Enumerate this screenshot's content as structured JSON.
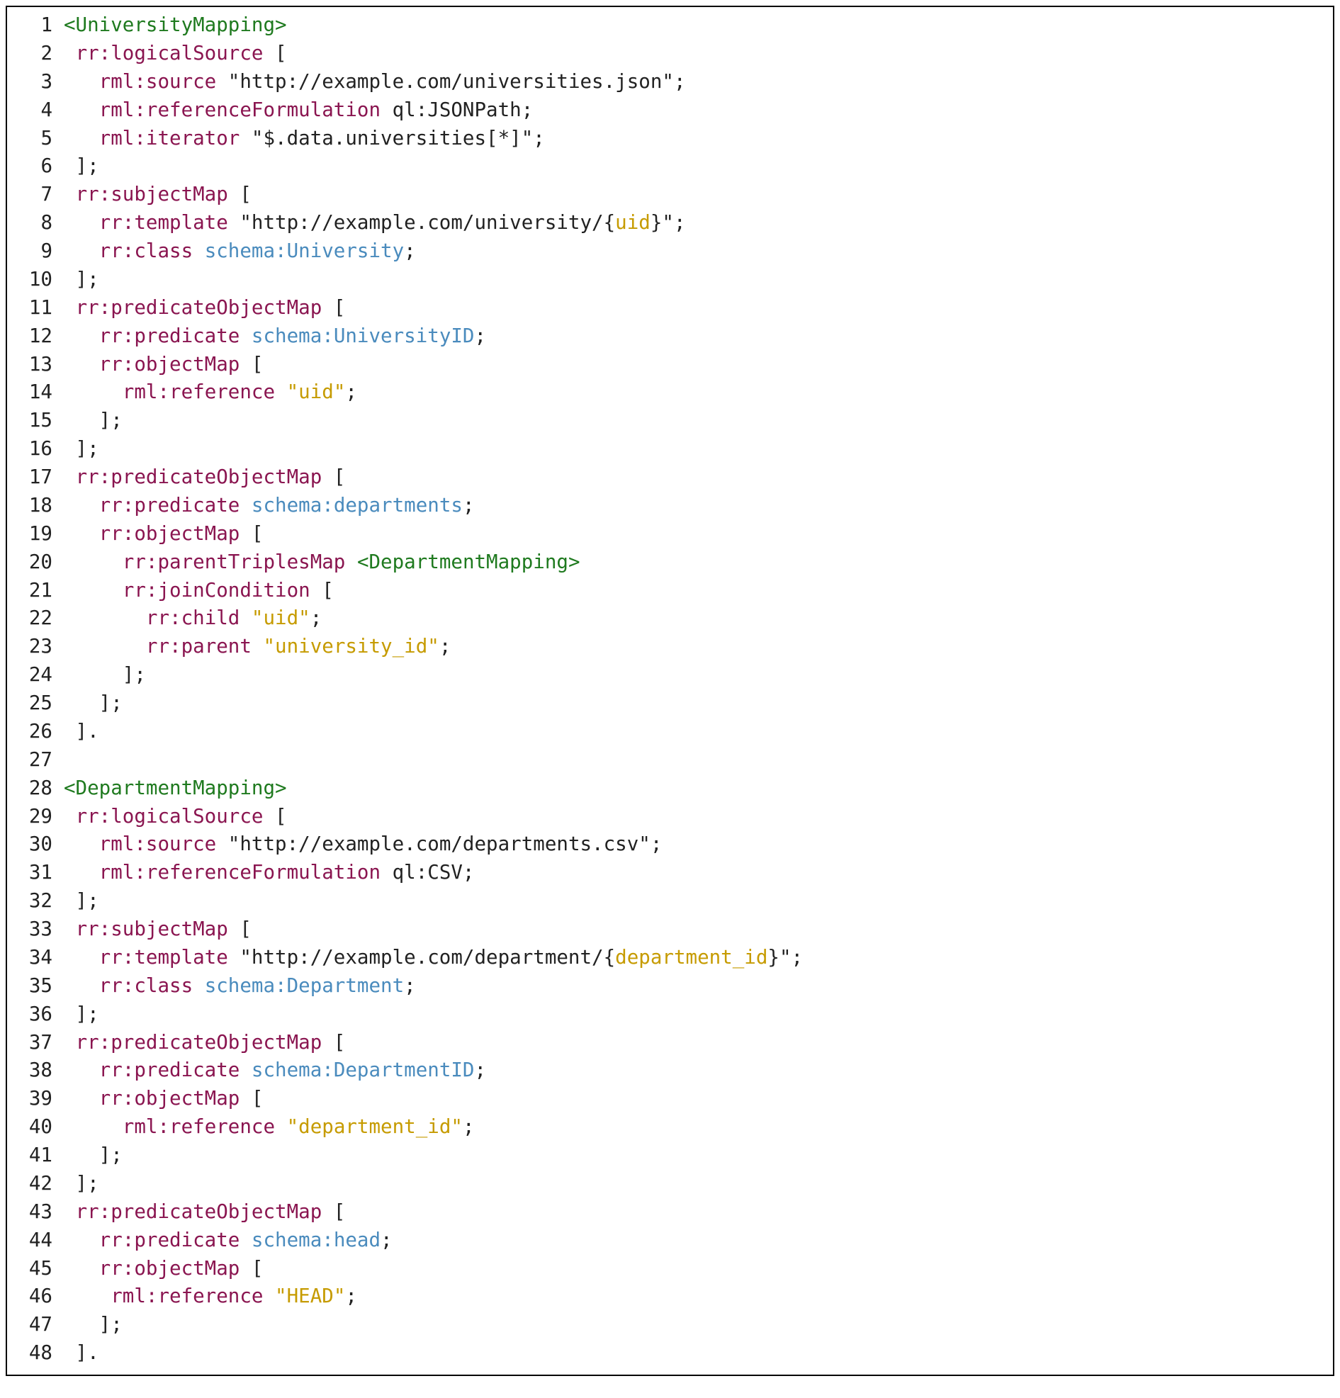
{
  "code": {
    "lines": [
      {
        "n": 1,
        "tokens": [
          {
            "c": "t-green",
            "t": "<UniversityMapping>"
          }
        ]
      },
      {
        "n": 2,
        "tokens": [
          {
            "c": "t-default",
            "t": " "
          },
          {
            "c": "t-maroon",
            "t": "rr:logicalSource"
          },
          {
            "c": "t-default",
            "t": " ["
          }
        ]
      },
      {
        "n": 3,
        "tokens": [
          {
            "c": "t-default",
            "t": "   "
          },
          {
            "c": "t-maroon",
            "t": "rml:source"
          },
          {
            "c": "t-default",
            "t": " \"http://example.com/universities.json\";"
          }
        ]
      },
      {
        "n": 4,
        "tokens": [
          {
            "c": "t-default",
            "t": "   "
          },
          {
            "c": "t-maroon",
            "t": "rml:referenceFormulation"
          },
          {
            "c": "t-default",
            "t": " ql:JSONPath;"
          }
        ]
      },
      {
        "n": 5,
        "tokens": [
          {
            "c": "t-default",
            "t": "   "
          },
          {
            "c": "t-maroon",
            "t": "rml:iterator"
          },
          {
            "c": "t-default",
            "t": " \"$.data.universities[*]\";"
          }
        ]
      },
      {
        "n": 6,
        "tokens": [
          {
            "c": "t-default",
            "t": " ];"
          }
        ]
      },
      {
        "n": 7,
        "tokens": [
          {
            "c": "t-default",
            "t": " "
          },
          {
            "c": "t-maroon",
            "t": "rr:subjectMap"
          },
          {
            "c": "t-default",
            "t": " ["
          }
        ]
      },
      {
        "n": 8,
        "tokens": [
          {
            "c": "t-default",
            "t": "   "
          },
          {
            "c": "t-maroon",
            "t": "rr:template"
          },
          {
            "c": "t-default",
            "t": " \"http://example.com/university/{"
          },
          {
            "c": "t-yellow",
            "t": "uid"
          },
          {
            "c": "t-default",
            "t": "}\";"
          }
        ]
      },
      {
        "n": 9,
        "tokens": [
          {
            "c": "t-default",
            "t": "   "
          },
          {
            "c": "t-maroon",
            "t": "rr:class"
          },
          {
            "c": "t-default",
            "t": " "
          },
          {
            "c": "t-blue",
            "t": "schema:University"
          },
          {
            "c": "t-default",
            "t": ";"
          }
        ]
      },
      {
        "n": 10,
        "tokens": [
          {
            "c": "t-default",
            "t": " ];"
          }
        ]
      },
      {
        "n": 11,
        "tokens": [
          {
            "c": "t-default",
            "t": " "
          },
          {
            "c": "t-maroon",
            "t": "rr:predicateObjectMap"
          },
          {
            "c": "t-default",
            "t": " ["
          }
        ]
      },
      {
        "n": 12,
        "tokens": [
          {
            "c": "t-default",
            "t": "   "
          },
          {
            "c": "t-maroon",
            "t": "rr:predicate"
          },
          {
            "c": "t-default",
            "t": " "
          },
          {
            "c": "t-blue",
            "t": "schema:UniversityID"
          },
          {
            "c": "t-default",
            "t": ";"
          }
        ]
      },
      {
        "n": 13,
        "tokens": [
          {
            "c": "t-default",
            "t": "   "
          },
          {
            "c": "t-maroon",
            "t": "rr:objectMap"
          },
          {
            "c": "t-default",
            "t": " ["
          }
        ]
      },
      {
        "n": 14,
        "tokens": [
          {
            "c": "t-default",
            "t": "     "
          },
          {
            "c": "t-maroon",
            "t": "rml:reference"
          },
          {
            "c": "t-default",
            "t": " "
          },
          {
            "c": "t-yellow",
            "t": "\"uid\""
          },
          {
            "c": "t-default",
            "t": ";"
          }
        ]
      },
      {
        "n": 15,
        "tokens": [
          {
            "c": "t-default",
            "t": "   ];"
          }
        ]
      },
      {
        "n": 16,
        "tokens": [
          {
            "c": "t-default",
            "t": " ];"
          }
        ]
      },
      {
        "n": 17,
        "tokens": [
          {
            "c": "t-default",
            "t": " "
          },
          {
            "c": "t-maroon",
            "t": "rr:predicateObjectMap"
          },
          {
            "c": "t-default",
            "t": " ["
          }
        ]
      },
      {
        "n": 18,
        "tokens": [
          {
            "c": "t-default",
            "t": "   "
          },
          {
            "c": "t-maroon",
            "t": "rr:predicate"
          },
          {
            "c": "t-default",
            "t": " "
          },
          {
            "c": "t-blue",
            "t": "schema:departments"
          },
          {
            "c": "t-default",
            "t": ";"
          }
        ]
      },
      {
        "n": 19,
        "tokens": [
          {
            "c": "t-default",
            "t": "   "
          },
          {
            "c": "t-maroon",
            "t": "rr:objectMap"
          },
          {
            "c": "t-default",
            "t": " ["
          }
        ]
      },
      {
        "n": 20,
        "tokens": [
          {
            "c": "t-default",
            "t": "     "
          },
          {
            "c": "t-maroon",
            "t": "rr:parentTriplesMap"
          },
          {
            "c": "t-default",
            "t": " "
          },
          {
            "c": "t-green",
            "t": "<DepartmentMapping>"
          }
        ]
      },
      {
        "n": 21,
        "tokens": [
          {
            "c": "t-default",
            "t": "     "
          },
          {
            "c": "t-maroon",
            "t": "rr:joinCondition"
          },
          {
            "c": "t-default",
            "t": " ["
          }
        ]
      },
      {
        "n": 22,
        "tokens": [
          {
            "c": "t-default",
            "t": "       "
          },
          {
            "c": "t-maroon",
            "t": "rr:child"
          },
          {
            "c": "t-default",
            "t": " "
          },
          {
            "c": "t-yellow",
            "t": "\"uid\""
          },
          {
            "c": "t-default",
            "t": ";"
          }
        ]
      },
      {
        "n": 23,
        "tokens": [
          {
            "c": "t-default",
            "t": "       "
          },
          {
            "c": "t-maroon",
            "t": "rr:parent"
          },
          {
            "c": "t-default",
            "t": " "
          },
          {
            "c": "t-yellow",
            "t": "\"university_id\""
          },
          {
            "c": "t-default",
            "t": ";"
          }
        ]
      },
      {
        "n": 24,
        "tokens": [
          {
            "c": "t-default",
            "t": "     ];"
          }
        ]
      },
      {
        "n": 25,
        "tokens": [
          {
            "c": "t-default",
            "t": "   ];"
          }
        ]
      },
      {
        "n": 26,
        "tokens": [
          {
            "c": "t-default",
            "t": " ]."
          }
        ]
      },
      {
        "n": 27,
        "tokens": [
          {
            "c": "t-default",
            "t": ""
          }
        ]
      },
      {
        "n": 28,
        "tokens": [
          {
            "c": "t-green",
            "t": "<DepartmentMapping>"
          }
        ]
      },
      {
        "n": 29,
        "tokens": [
          {
            "c": "t-default",
            "t": " "
          },
          {
            "c": "t-maroon",
            "t": "rr:logicalSource"
          },
          {
            "c": "t-default",
            "t": " ["
          }
        ]
      },
      {
        "n": 30,
        "tokens": [
          {
            "c": "t-default",
            "t": "   "
          },
          {
            "c": "t-maroon",
            "t": "rml:source"
          },
          {
            "c": "t-default",
            "t": " \"http://example.com/departments.csv\";"
          }
        ]
      },
      {
        "n": 31,
        "tokens": [
          {
            "c": "t-default",
            "t": "   "
          },
          {
            "c": "t-maroon",
            "t": "rml:referenceFormulation"
          },
          {
            "c": "t-default",
            "t": " ql:CSV;"
          }
        ]
      },
      {
        "n": 32,
        "tokens": [
          {
            "c": "t-default",
            "t": " ];"
          }
        ]
      },
      {
        "n": 33,
        "tokens": [
          {
            "c": "t-default",
            "t": " "
          },
          {
            "c": "t-maroon",
            "t": "rr:subjectMap"
          },
          {
            "c": "t-default",
            "t": " ["
          }
        ]
      },
      {
        "n": 34,
        "tokens": [
          {
            "c": "t-default",
            "t": "   "
          },
          {
            "c": "t-maroon",
            "t": "rr:template"
          },
          {
            "c": "t-default",
            "t": " \"http://example.com/department/{"
          },
          {
            "c": "t-yellow",
            "t": "department_id"
          },
          {
            "c": "t-default",
            "t": "}\";"
          }
        ]
      },
      {
        "n": 35,
        "tokens": [
          {
            "c": "t-default",
            "t": "   "
          },
          {
            "c": "t-maroon",
            "t": "rr:class"
          },
          {
            "c": "t-default",
            "t": " "
          },
          {
            "c": "t-blue",
            "t": "schema:Department"
          },
          {
            "c": "t-default",
            "t": ";"
          }
        ]
      },
      {
        "n": 36,
        "tokens": [
          {
            "c": "t-default",
            "t": " ];"
          }
        ]
      },
      {
        "n": 37,
        "tokens": [
          {
            "c": "t-default",
            "t": " "
          },
          {
            "c": "t-maroon",
            "t": "rr:predicateObjectMap"
          },
          {
            "c": "t-default",
            "t": " ["
          }
        ]
      },
      {
        "n": 38,
        "tokens": [
          {
            "c": "t-default",
            "t": "   "
          },
          {
            "c": "t-maroon",
            "t": "rr:predicate"
          },
          {
            "c": "t-default",
            "t": " "
          },
          {
            "c": "t-blue",
            "t": "schema:DepartmentID"
          },
          {
            "c": "t-default",
            "t": ";"
          }
        ]
      },
      {
        "n": 39,
        "tokens": [
          {
            "c": "t-default",
            "t": "   "
          },
          {
            "c": "t-maroon",
            "t": "rr:objectMap"
          },
          {
            "c": "t-default",
            "t": " ["
          }
        ]
      },
      {
        "n": 40,
        "tokens": [
          {
            "c": "t-default",
            "t": "     "
          },
          {
            "c": "t-maroon",
            "t": "rml:reference"
          },
          {
            "c": "t-default",
            "t": " "
          },
          {
            "c": "t-yellow",
            "t": "\"department_id\""
          },
          {
            "c": "t-default",
            "t": ";"
          }
        ]
      },
      {
        "n": 41,
        "tokens": [
          {
            "c": "t-default",
            "t": "   ];"
          }
        ]
      },
      {
        "n": 42,
        "tokens": [
          {
            "c": "t-default",
            "t": " ];"
          }
        ]
      },
      {
        "n": 43,
        "tokens": [
          {
            "c": "t-default",
            "t": " "
          },
          {
            "c": "t-maroon",
            "t": "rr:predicateObjectMap"
          },
          {
            "c": "t-default",
            "t": " ["
          }
        ]
      },
      {
        "n": 44,
        "tokens": [
          {
            "c": "t-default",
            "t": "   "
          },
          {
            "c": "t-maroon",
            "t": "rr:predicate"
          },
          {
            "c": "t-default",
            "t": " "
          },
          {
            "c": "t-blue",
            "t": "schema:head"
          },
          {
            "c": "t-default",
            "t": ";"
          }
        ]
      },
      {
        "n": 45,
        "tokens": [
          {
            "c": "t-default",
            "t": "   "
          },
          {
            "c": "t-maroon",
            "t": "rr:objectMap"
          },
          {
            "c": "t-default",
            "t": " ["
          }
        ]
      },
      {
        "n": 46,
        "tokens": [
          {
            "c": "t-default",
            "t": "    "
          },
          {
            "c": "t-maroon",
            "t": "rml:reference"
          },
          {
            "c": "t-default",
            "t": " "
          },
          {
            "c": "t-yellow",
            "t": "\"HEAD\""
          },
          {
            "c": "t-default",
            "t": ";"
          }
        ]
      },
      {
        "n": 47,
        "tokens": [
          {
            "c": "t-default",
            "t": "   ];"
          }
        ]
      },
      {
        "n": 48,
        "tokens": [
          {
            "c": "t-default",
            "t": " ]."
          }
        ]
      }
    ]
  }
}
